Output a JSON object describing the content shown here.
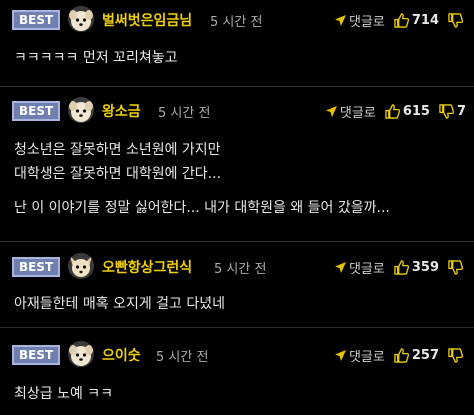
{
  "comments": [
    {
      "badge": "BEST",
      "nickname": "벌써벗은임금님",
      "time": "5 시간 전",
      "reply_label": "댓글로",
      "likes": "714",
      "dislikes": "",
      "lines": [
        "ㅋㅋㅋㅋㅋ 먼저 꼬리쳐놓고"
      ]
    },
    {
      "badge": "BEST",
      "nickname": "왕소금",
      "time": "5 시간 전",
      "reply_label": "댓글로",
      "likes": "615",
      "dislikes": "7",
      "lines": [
        "청소년은 잘못하면 소년원에 가지만",
        "대학생은 잘못하면 대학원에 간다...",
        "",
        "난 이 이야기를 정말 싫어한다... 내가 대학원을 왜 들어 갔을까..."
      ]
    },
    {
      "badge": "BEST",
      "nickname": "오빤항상그런식",
      "time": "5 시간 전",
      "reply_label": "댓글로",
      "likes": "359",
      "dislikes": "",
      "lines": [
        "아재들한테 매혹 오지게 걸고 다녔네"
      ]
    },
    {
      "badge": "BEST",
      "nickname": "으이숫",
      "time": "5 시간 전",
      "reply_label": "댓글로",
      "likes": "257",
      "dislikes": "",
      "lines": [
        "최상급 노예 ㅋㅋ"
      ]
    }
  ],
  "colors": {
    "background": "#000000",
    "nickname": "#f0d000",
    "badge": "#6f7fb0",
    "text": "#e8e8e8"
  }
}
